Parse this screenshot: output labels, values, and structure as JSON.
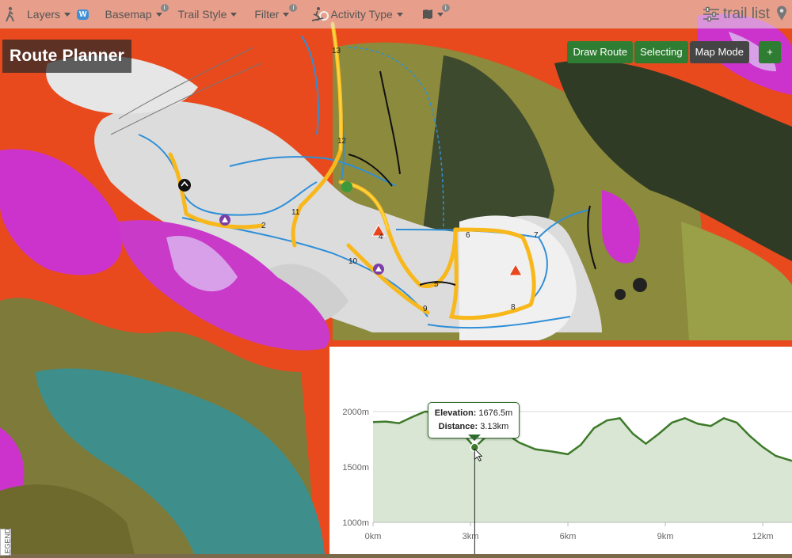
{
  "app": {
    "title": "Route Planner"
  },
  "menu": {
    "layers": "Layers",
    "layers_badge": "W",
    "basemap": "Basemap",
    "trail_style": "Trail Style",
    "filter": "Filter",
    "activity_type": "Activity Type",
    "trail_list": "trail list"
  },
  "toolbar": {
    "draw_route": "Draw Route",
    "selecting": "Selecting",
    "map_mode": "Map Mode",
    "add": "+"
  },
  "legend": {
    "label": "LEGEND"
  },
  "route_markers": [
    {
      "label": "2"
    },
    {
      "label": "4"
    },
    {
      "label": "5"
    },
    {
      "label": "6"
    },
    {
      "label": "7"
    },
    {
      "label": "8"
    },
    {
      "label": "9"
    },
    {
      "label": "10"
    },
    {
      "label": "11"
    },
    {
      "label": "12"
    },
    {
      "label": "13"
    }
  ],
  "elevation_profile": {
    "tooltip": {
      "elevation_label": "Elevation:",
      "elevation_value": "1676.5m",
      "distance_label": "Distance:",
      "distance_value": "3.13km"
    }
  },
  "chart_data": {
    "type": "area",
    "xlabel": "",
    "ylabel": "",
    "x_unit": "km",
    "y_unit": "m",
    "x_ticks": [
      "0km",
      "3km",
      "6km",
      "9km",
      "12km"
    ],
    "y_ticks": [
      "1000m",
      "1500m",
      "2000m"
    ],
    "xlim": [
      0,
      12.9
    ],
    "ylim": [
      1000,
      2000
    ],
    "series": [
      {
        "x": [
          0,
          0.4,
          0.8,
          1.2,
          1.6,
          2.0,
          2.4,
          2.8,
          3.13,
          3.5,
          4.0,
          4.5,
          5.0,
          5.5,
          6.0,
          6.4,
          6.8,
          7.2,
          7.6,
          8.0,
          8.4,
          8.8,
          9.2,
          9.6,
          10.0,
          10.4,
          10.8,
          11.2,
          11.6,
          12.0,
          12.4,
          12.9
        ],
        "y": [
          1905,
          1910,
          1895,
          1950,
          2000,
          1990,
          1900,
          1790,
          1676,
          1780,
          1820,
          1720,
          1660,
          1640,
          1615,
          1700,
          1850,
          1920,
          1940,
          1800,
          1710,
          1800,
          1900,
          1940,
          1890,
          1870,
          1940,
          1900,
          1780,
          1680,
          1600,
          1555
        ]
      }
    ],
    "highlight": {
      "x": 3.13,
      "y": 1676.5
    }
  }
}
